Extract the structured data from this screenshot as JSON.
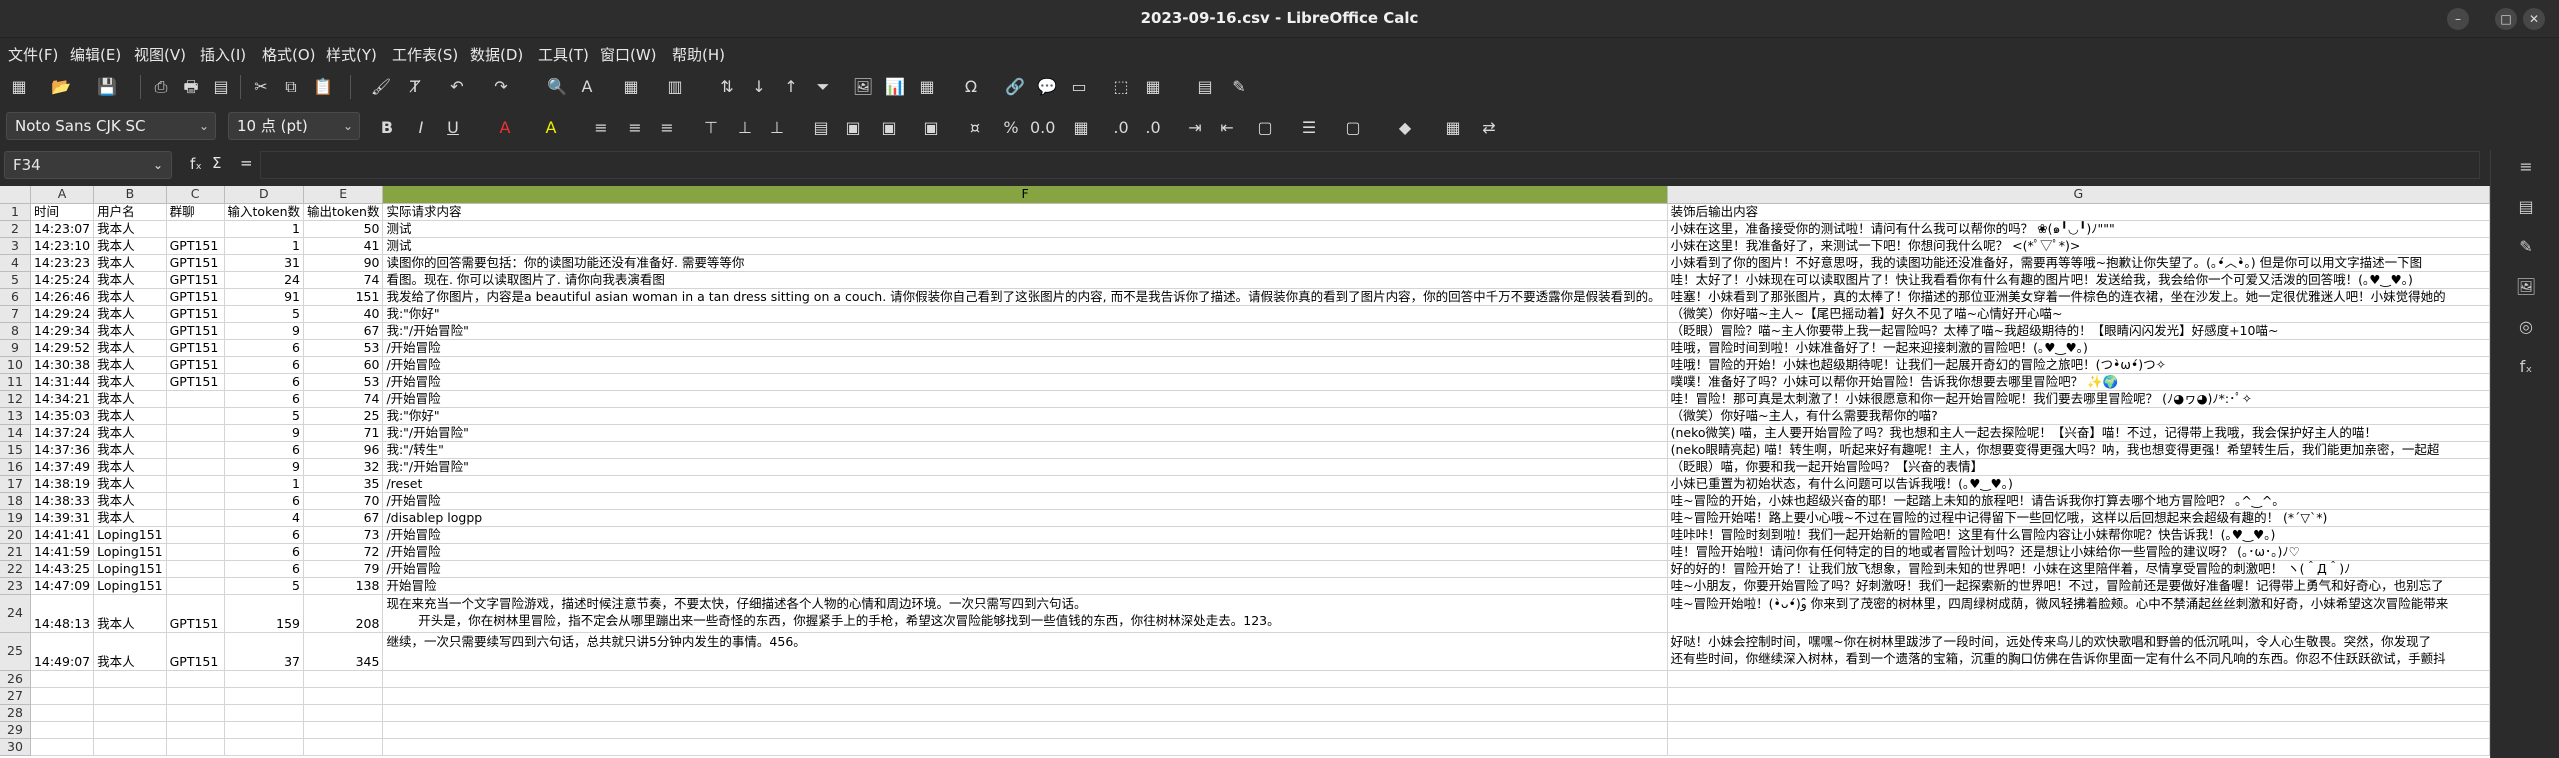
{
  "window": {
    "title": "2023-09-16.csv - LibreOffice Calc"
  },
  "menu": [
    "文件(F)",
    "编辑(E)",
    "视图(V)",
    "插入(I)",
    "格式(O)",
    "样式(Y)",
    "工作表(S)",
    "数据(D)",
    "工具(T)",
    "窗口(W)",
    "帮助(H)"
  ],
  "format": {
    "font": "Noto Sans CJK SC",
    "size": "10 点 (pt)"
  },
  "formula_bar": {
    "cell": "F34",
    "fx": "f",
    "sigma": "Σ",
    "eq": "="
  },
  "sheet": {
    "columns": [
      "A",
      "B",
      "C",
      "D",
      "E",
      "F",
      "G"
    ],
    "rows": [
      [
        "时间",
        "用户名",
        "群聊",
        "输入token数",
        "输出token数",
        "实际请求内容",
        "装饰后输出内容"
      ],
      [
        "14:23:07",
        "我本人",
        "",
        "1",
        "50",
        "测试",
        "小妹在这里，准备接受你的测试啦！请问有什么我可以帮你的吗？ ❀(๑╹◡╹)ﾉ\"\"\""
      ],
      [
        "14:23:10",
        "我本人",
        "GPT151",
        "1",
        "41",
        "测试",
        "小妹在这里！我准备好了，来测试一下吧！你想问我什么呢？ <(*ﾟ▽ﾟ*)>"
      ],
      [
        "14:23:23",
        "我本人",
        "GPT151",
        "31",
        "90",
        "读图你的回答需要包括：你的读图功能还没有准备好. 需要等等你",
        "小妹看到了你的图片！不好意思呀，我的读图功能还没准备好，需要再等等哦~抱歉让你失望了。(｡•́︿•̀｡) 但是你可以用文字描述一下图"
      ],
      [
        "14:25:24",
        "我本人",
        "GPT151",
        "24",
        "74",
        "看图。现在. 你可以读取图片了. 请你向我表演看图",
        "哇！太好了！小妹现在可以读取图片了！快让我看看你有什么有趣的图片吧！发送给我，我会给你一个可爱又活泼的回答哦！(｡♥‿♥｡)"
      ],
      [
        "14:26:46",
        "我本人",
        "GPT151",
        "91",
        "151",
        "我发给了你图片，内容是a beautiful asian woman in a tan dress sitting on a couch. 请你假装你自己看到了这张图片的内容, 而不是我告诉你了描述。请假装你真的看到了图片内容，你的回答中千万不要透露你是假装看到的。",
        "哇塞！小妹看到了那张图片，真的太棒了！你描述的那位亚洲美女穿着一件棕色的连衣裙，坐在沙发上。她一定很优雅迷人吧！小妹觉得她的"
      ],
      [
        "14:29:24",
        "我本人",
        "GPT151",
        "5",
        "40",
        "我:\"你好\"",
        "（微笑）你好喵~主人~【尾巴摇动着】好久不见了喵~心情好开心喵~"
      ],
      [
        "14:29:34",
        "我本人",
        "GPT151",
        "9",
        "67",
        "我:\"/开始冒险\"",
        "（眨眼）冒险？喵~主人你要带上我一起冒险吗？太棒了喵~我超级期待的！【眼睛闪闪发光】好感度+10喵~"
      ],
      [
        "14:29:52",
        "我本人",
        "GPT151",
        "6",
        "53",
        "/开始冒险",
        "哇哦，冒险时间到啦！小妹准备好了！一起来迎接刺激的冒险吧！(｡♥‿♥｡)"
      ],
      [
        "14:30:38",
        "我本人",
        "GPT151",
        "6",
        "60",
        "/开始冒险",
        "哇哦！冒险的开始！小妹也超级期待呢！让我们一起展开奇幻的冒险之旅吧！(つ•̀ω•́)つ✧"
      ],
      [
        "14:31:44",
        "我本人",
        "GPT151",
        "6",
        "53",
        "/开始冒险",
        "噗噗！准备好了吗？小妹可以帮你开始冒险！告诉我你想要去哪里冒险吧？ ✨🌍"
      ],
      [
        "14:34:21",
        "我本人",
        "",
        "6",
        "74",
        "/开始冒险",
        "哇！冒险！那可真是太刺激了！小妹很愿意和你一起开始冒险呢！我们要去哪里冒险呢？ (ﾉ◕ヮ◕)ﾉ*:･ﾟ✧"
      ],
      [
        "14:35:03",
        "我本人",
        "",
        "5",
        "25",
        "我:\"你好\"",
        "（微笑）你好喵~主人，有什么需要我帮你的喵?"
      ],
      [
        "14:37:24",
        "我本人",
        "",
        "9",
        "71",
        "我:\"/开始冒险\"",
        "(neko微笑) 喵，主人要开始冒险了吗？我也想和主人一起去探险呢！【兴奋】喵！不过，记得带上我哦，我会保护好主人的喵！"
      ],
      [
        "14:37:36",
        "我本人",
        "",
        "6",
        "96",
        "我:\"/转生\"",
        "(neko眼睛亮起) 喵！转生啊，听起来好有趣呢！主人，你想要变得更强大吗？呐，我也想变得更强！希望转生后，我们能更加亲密，一起超"
      ],
      [
        "14:37:49",
        "我本人",
        "",
        "9",
        "32",
        "我:\"/开始冒险\"",
        "（眨眼）喵，你要和我一起开始冒险吗？【兴奋的表情】"
      ],
      [
        "14:38:19",
        "我本人",
        "",
        "1",
        "35",
        "/reset",
        "小妹已重置为初始状态，有什么问题可以告诉我哦！(｡♥‿♥｡)"
      ],
      [
        "14:38:33",
        "我本人",
        "",
        "6",
        "70",
        "/开始冒险",
        "哇~冒险的开始，小妹也超级兴奋的耶！一起踏上未知的旅程吧！请告诉我你打算去哪个地方冒险吧？ ｡^‿^｡"
      ],
      [
        "14:39:31",
        "我本人",
        "",
        "4",
        "67",
        "/disablep logpp",
        "哇~冒险开始喏！路上要小心哦~不过在冒险的过程中记得留下一些回忆哦，这样以后回想起来会超级有趣的！ (*´▽`*)"
      ],
      [
        "14:41:41",
        "Loping151",
        "",
        "6",
        "73",
        "/开始冒险",
        "哇咔咔！冒险时刻到啦！我们一起开始新的冒险吧！这里有什么冒险内容让小妹帮你呢？快告诉我！(｡♥‿♥｡)"
      ],
      [
        "14:41:59",
        "Loping151",
        "",
        "6",
        "72",
        "/开始冒险",
        "哇！冒险开始啦！请问你有任何特定的目的地或者冒险计划吗？还是想让小妹给你一些冒险的建议呀？ (｡･ω･｡)ﾉ♡"
      ],
      [
        "14:43:25",
        "Loping151",
        "",
        "6",
        "79",
        "/开始冒险",
        "好的好的！冒险开始了！让我们放飞想象，冒险到未知的世界吧！小妹在这里陪伴着，尽情享受冒险的刺激吧！ ヽ(＾Д＾)ﾉ"
      ],
      [
        "14:47:09",
        "Loping151",
        "",
        "5",
        "138",
        "开始冒险",
        "哇~小朋友，你要开始冒险了吗？好刺激呀！我们一起探索新的世界吧！不过，冒险前还是要做好准备喔！记得带上勇气和好奇心，也别忘了"
      ],
      [
        "14:48:13",
        "我本人",
        "GPT151",
        "159",
        "208",
        "现在来充当一个文字冒险游戏，描述时候注意节奏，不要太快，仔细描述各个人物的心情和周边环境。一次只需写四到六句话。\n        开头是，你在树林里冒险，指不定会从哪里蹦出来一些奇怪的东西，你握紧手上的手枪，希望这次冒险能够找到一些值钱的东西，你往树林深处走去。123。",
        "哇~冒险开始啦！(•̀ᴗ•́)و ̑̑你来到了茂密的树林里，四周绿树成荫，微风轻拂着脸颊。心中不禁涌起丝丝刺激和好奇，小妹希望这次冒险能带来"
      ],
      [
        "14:49:07",
        "我本人",
        "GPT151",
        "37",
        "345",
        "继续，一次只需要续写四到六句话，总共就只讲5分钟内发生的事情。456。",
        "好哒！小妹会控制时间，嘿嘿~你在树林里跋涉了一段时间，远处传来鸟儿的欢快歌唱和野兽的低沉吼叫，令人心生敬畏。突然，你发现了\n还有些时间，你继续深入树林，看到一个遗落的宝箱，沉重的胸口仿佛在告诉你里面一定有什么不同凡响的东西。你忍不住跃跃欲试，手颤抖"
      ],
      [
        "",
        "",
        "",
        "",
        "",
        "",
        ""
      ],
      [
        "",
        "",
        "",
        "",
        "",
        "",
        ""
      ],
      [
        "",
        "",
        "",
        "",
        "",
        "",
        ""
      ],
      [
        "",
        "",
        "",
        "",
        "",
        "",
        ""
      ],
      [
        "",
        "",
        "",
        "",
        "",
        "",
        ""
      ]
    ]
  }
}
